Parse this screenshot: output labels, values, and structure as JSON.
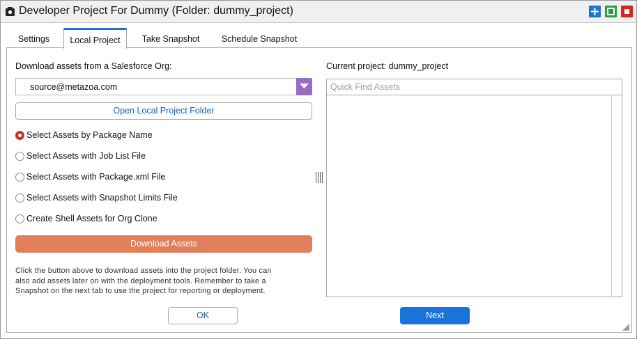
{
  "window": {
    "title": "Developer Project For Dummy (Folder: dummy_project)"
  },
  "tabs": [
    {
      "label": "Settings",
      "active": false
    },
    {
      "label": "Local Project",
      "active": true
    },
    {
      "label": "Take Snapshot",
      "active": false
    },
    {
      "label": "Schedule Snapshot",
      "active": false
    }
  ],
  "left": {
    "org_label": "Download assets from a Salesforce Org:",
    "org_select_value": "source@metazoa.com",
    "open_folder_label": "Open Local Project Folder",
    "options": [
      {
        "label": "Select Assets by Package Name",
        "selected": true
      },
      {
        "label": "Select Assets with Job List File",
        "selected": false
      },
      {
        "label": "Select Assets with Package.xml File",
        "selected": false
      },
      {
        "label": "Select Assets with Snapshot Limits File",
        "selected": false
      },
      {
        "label": "Create Shell Assets for Org Clone",
        "selected": false
      }
    ],
    "download_label": "Download Assets",
    "help_lines": [
      "Click the button above to download assets into the project folder. You can",
      "also add assets later on with the deployment tools. Remember to take a",
      "Snapshot on the next tab to use the project for reporting or deployment."
    ]
  },
  "right": {
    "current_project_label": "Current project: dummy_project",
    "search_placeholder": "Quick Find Assets"
  },
  "footer": {
    "ok_label": "OK",
    "next_label": "Next"
  },
  "colors": {
    "accent_blue": "#1a73d9",
    "download_orange": "#e07f5a",
    "select_arrow_purple": "#9b6bc1",
    "radio_red": "#c9302c",
    "max_button": "#1a73d9",
    "restore_button": "#23a047",
    "close_button": "#d9251c"
  }
}
